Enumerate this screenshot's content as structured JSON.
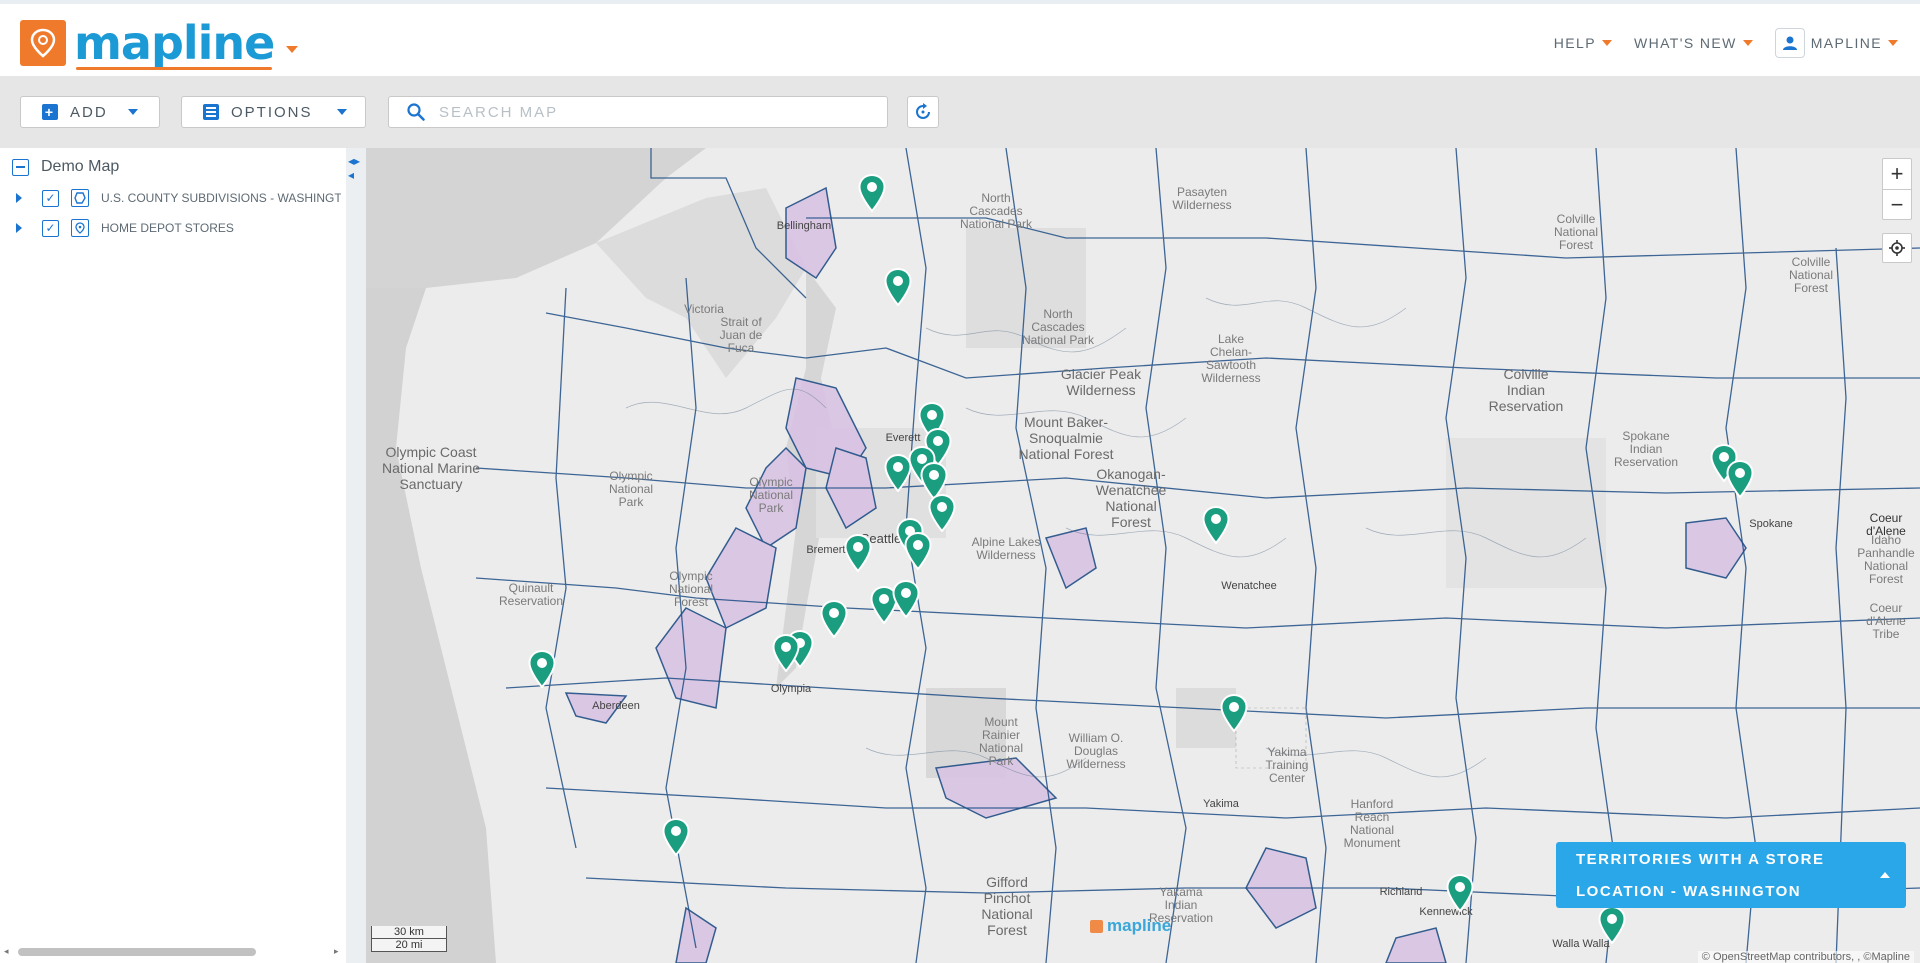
{
  "app": {
    "name": "mapline"
  },
  "topnav": {
    "help": "HELP",
    "whats_new": "WHAT'S NEW",
    "user": "MAPLINE"
  },
  "toolbar": {
    "add": "ADD",
    "options": "OPTIONS",
    "search_placeholder": "SEARCH MAP"
  },
  "sidebar": {
    "map_title": "Demo Map",
    "layers": [
      {
        "label": "U.S. COUNTY SUBDIVISIONS - WASHINGTON",
        "checked": true
      },
      {
        "label": "HOME DEPOT STORES",
        "checked": true
      }
    ]
  },
  "map": {
    "legend": {
      "line1": "TERRITORIES WITH A STORE",
      "line2": "LOCATION - WASHINGTON"
    },
    "scale": {
      "km": "30 km",
      "mi": "20 mi"
    },
    "attribution": "© OpenStreetMap contributors, , ©Mapline",
    "watermark": "mapline",
    "labels": {
      "north_cascades": "North Cascades National Park",
      "north_cascades2": "North Cascades National Park",
      "pasayten": "Pasayten Wilderness",
      "victoria": "Victoria",
      "juan_de_fuca": "Strait of Juan de Fuca",
      "olympic_coast": "Olympic Coast National Marine Sanctuary",
      "olympic_np": "Olympic National Park",
      "olympic_np2": "Olympic National Park",
      "olympic_nf": "Olympic National Forest",
      "glacier_peak": "Glacier Peak Wilderness",
      "lake_chelan": "Lake Chelan-Sawtooth Wilderness",
      "mt_baker": "Mount Baker-Snoqualmie National Forest",
      "okanogan": "Okanogan-Wenatchee National Forest",
      "colville_res": "Colville Indian Reservation",
      "colville_nf": "Colville National Forest",
      "colville_nf2": "Colville National Forest",
      "spokane_res": "Spokane Indian Reservation",
      "quinault": "Quinault Reservation",
      "alpine_lakes": "Alpine Lakes Wilderness",
      "mt_rainier": "Mount Rainier National Park",
      "william_douglas": "William O. Douglas Wilderness",
      "yakima_tc": "Yakima Training Center",
      "hanford": "Hanford Reach National Monument",
      "gifford": "Gifford Pinchot National Forest",
      "yakama": "Yakama Indian Reservation",
      "coeur": "Coeur d'Alene",
      "idaho": "Idaho Panhandle National Forest",
      "coeur_tribe": "Coeur d'Alene Tribe",
      "wenatchee_city": "Wenatchee",
      "bellingham": "Bellingham",
      "everett": "Everett",
      "seattle": "Seattle",
      "bremerton": "Bremerton",
      "olympia": "Olympia",
      "aberdeen": "Aberdeen",
      "yakima": "Yakima",
      "kennewick": "Kennewick",
      "richland": "Richland",
      "walla_walla": "Walla Walla",
      "spokane": "Spokane",
      "wenatchee_nf": "Wenatchee"
    },
    "pin_color": "#1a9e7f",
    "territory_color": "#d9c3e4",
    "boundary_color": "#1f4e86"
  }
}
